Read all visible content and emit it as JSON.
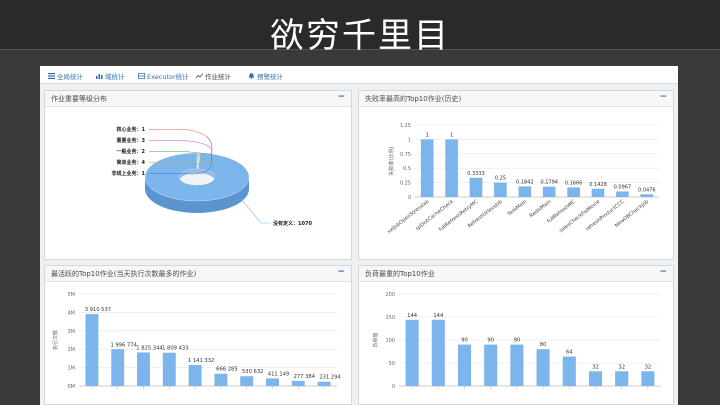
{
  "slide": {
    "title": "欲穷千里目"
  },
  "tabs": [
    {
      "label": "全局统计",
      "icon": "list-icon"
    },
    {
      "label": "域统计",
      "icon": "bar-chart-icon"
    },
    {
      "label": "Executor统计",
      "icon": "table-icon"
    },
    {
      "label": "作业统计",
      "icon": "line-chart-icon"
    },
    {
      "label": "预警统计",
      "icon": "bell-icon"
    }
  ],
  "panels": {
    "importance": {
      "title": "作业重要等级分布",
      "min_label": "−"
    },
    "failure": {
      "title": "失败率最高的Top10作业(历史)",
      "min_label": "−"
    },
    "active": {
      "title": "最活跃的Top10作业(当天执行次数最多的作业)",
      "min_label": "−"
    },
    "load": {
      "title": "负荷最重的Top10作业",
      "min_label": "−"
    }
  },
  "colors": {
    "bar": "#7cb5ec",
    "pie_main": "#7cb5ec",
    "pie_side": "#5b95cf",
    "accent": "#2f6fb0"
  },
  "chart_data": [
    {
      "id": "importance",
      "type": "pie",
      "variant": "donut-3d",
      "slices": [
        {
          "label": "核心业务",
          "value": 1,
          "color": "#e05a5a"
        },
        {
          "label": "重要业务",
          "value": 3,
          "color": "#b25ec8"
        },
        {
          "label": "一般业务",
          "value": 2,
          "color": "#5a9e4a"
        },
        {
          "label": "简单业务",
          "value": 4,
          "color": "#c9a94a"
        },
        {
          "label": "非线上业务",
          "value": 1,
          "color": "#3f7fc4"
        },
        {
          "label": "没有定义",
          "value": 1070,
          "color": "#7cb5ec"
        }
      ]
    },
    {
      "id": "failure",
      "type": "bar",
      "ylabel": "失败率(比例)",
      "ylim": [
        0,
        1.25
      ],
      "yticks": [
        "0",
        "0.25",
        "0.5",
        "0.75",
        "1",
        "1.25"
      ],
      "ytick_values": [
        0,
        0.25,
        0.5,
        0.75,
        1,
        1.25
      ],
      "categories": [
        "xxlJobOpenStresslab",
        "spDistCacheCheck",
        "fullRefreshRetryMC",
        "RefreshUrlessJob",
        "TaskMain",
        "RedisMain",
        "fullRefreshMC",
        "salesCheckFaiMovie",
        "refreshProductCCC",
        "NewDBCheckJob"
      ],
      "values": [
        1,
        1,
        0.3333,
        0.25,
        0.1842,
        0.1794,
        0.1666,
        0.1428,
        0.0967,
        0.0476
      ],
      "value_labels": [
        "1",
        "1",
        "0.3333",
        "0.25",
        "0.1842",
        "0.1794",
        "0.1666",
        "0.1428",
        "0.0967",
        "0.0476"
      ]
    },
    {
      "id": "active",
      "type": "bar",
      "ylabel": "执行次数",
      "ylim": [
        0,
        5000000
      ],
      "yticks": [
        "0M",
        "1M",
        "2M",
        "3M",
        "4M",
        "5M"
      ],
      "ytick_values": [
        0,
        1000000,
        2000000,
        3000000,
        4000000,
        5000000
      ],
      "categories": [
        "",
        "",
        "",
        "",
        "",
        "",
        "",
        "",
        "",
        ""
      ],
      "values": [
        3910537,
        1996774,
        1825344,
        1809433,
        1141332,
        666285,
        530632,
        411149,
        277384,
        231294
      ],
      "value_labels": [
        "3 910 537",
        "1 996 774",
        "1 825 344",
        "1 809 433",
        "1 141 332",
        "666 285",
        "530 632",
        "411 149",
        "277 384",
        "231 294"
      ]
    },
    {
      "id": "load",
      "type": "bar",
      "ylabel": "负荷值",
      "ylim": [
        0,
        200
      ],
      "yticks": [
        "0",
        "50",
        "100",
        "150",
        "200"
      ],
      "ytick_values": [
        0,
        50,
        100,
        150,
        200
      ],
      "categories": [
        "",
        "",
        "",
        "",
        "",
        "",
        "",
        "",
        "",
        ""
      ],
      "values": [
        144,
        144,
        90,
        90,
        90,
        80,
        64,
        32,
        32,
        32
      ],
      "value_labels": [
        "144",
        "144",
        "90",
        "90",
        "90",
        "80",
        "64",
        "32",
        "32",
        "32"
      ]
    }
  ]
}
